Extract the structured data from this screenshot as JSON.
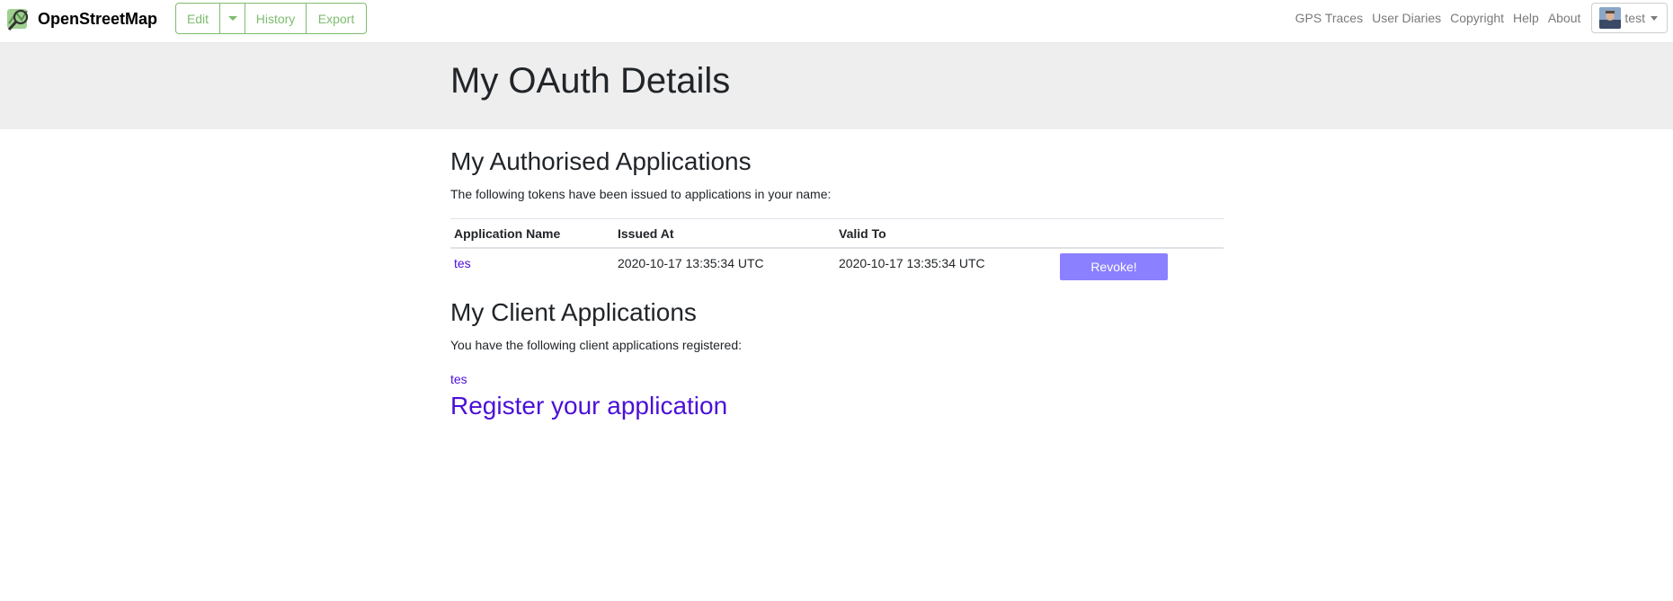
{
  "header": {
    "brand": "OpenStreetMap",
    "edit_label": "Edit",
    "history_label": "History",
    "export_label": "Export",
    "nav_links": [
      "GPS Traces",
      "User Diaries",
      "Copyright",
      "Help",
      "About"
    ],
    "user_name": "test",
    "accent_color": "#7ebc6f"
  },
  "page": {
    "title": "My OAuth Details"
  },
  "authorised": {
    "heading": "My Authorised Applications",
    "intro": "The following tokens have been issued to applications in your name:",
    "columns": [
      "Application Name",
      "Issued At",
      "Valid To"
    ],
    "rows": [
      {
        "name": "tes",
        "issued_at": "2020-10-17 13:35:34 UTC",
        "valid_to": "2020-10-17 13:35:34 UTC",
        "action": "Revoke!"
      }
    ]
  },
  "clients": {
    "heading": "My Client Applications",
    "intro": "You have the following client applications registered:",
    "apps": [
      "tes"
    ],
    "register_link": "Register your application"
  },
  "colors": {
    "link": "#4b0fd8",
    "revoke_button": "#8b80ff",
    "title_band": "#eeeeee"
  }
}
